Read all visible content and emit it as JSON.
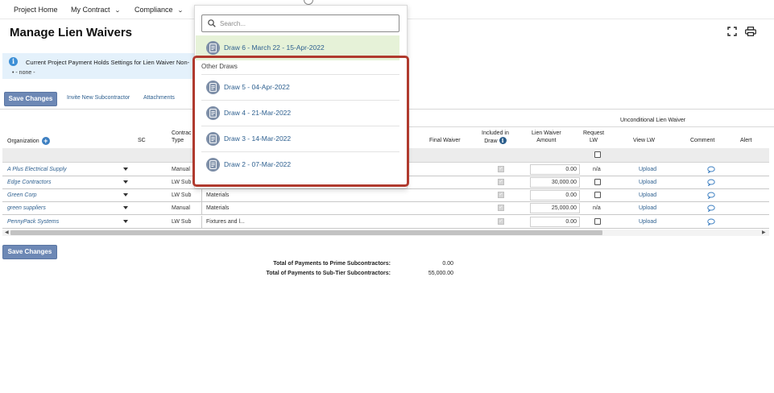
{
  "nav": {
    "project_home": "Project Home",
    "my_contract": "My Contract",
    "compliance": "Compliance"
  },
  "page_title": "Manage Lien Waivers",
  "icons": {
    "expand": "fullscreen-icon",
    "print": "print-icon",
    "search": "search-icon",
    "draw": "document-icon",
    "comment": "comment-bubble-icon",
    "add": "plus-circle-icon",
    "info": "info-icon"
  },
  "colors": {
    "primary_button": "#6d88b5",
    "link": "#2d5f8f",
    "selected_bg": "#e6f2d8",
    "highlight_border": "#b03a2e",
    "banner_bg": "#e4f1fb"
  },
  "banner": {
    "icon": "i",
    "text": "Current Project Payment Holds Settings for Lien Waiver Non-",
    "sub": "•  - none -"
  },
  "toolbar": {
    "save_label": "Save Changes",
    "invite_label": "Invite New Subcontractor",
    "attachments_label": "Attachments"
  },
  "table": {
    "group_header": "Unconditional Lien Waiver",
    "headers": {
      "organization": "Organization",
      "sc": "SC",
      "contract_type_1": "Contrac",
      "contract_type_2": "Type",
      "final_waiver": "Final Waiver",
      "included_1": "Included in",
      "included_2": "Draw",
      "lw_amount_1": "Lien Waiver",
      "lw_amount_2": "Amount",
      "request_1": "Request",
      "request_2": "LW",
      "view_lw": "View LW",
      "comment": "Comment",
      "alert": "Alert"
    },
    "rows": [
      {
        "org": "A Plus Electrical Supply",
        "type": "Manual",
        "desc": "",
        "amount": "0.00",
        "request": "n/a",
        "view": "Upload"
      },
      {
        "org": "Edge Contractors",
        "type": "LW Sub",
        "desc": "",
        "amount": "30,000.00",
        "request": "",
        "view": "Upload"
      },
      {
        "org": "Green Corp",
        "type": "LW Sub",
        "desc": "Materials",
        "amount": "0.00",
        "request": "",
        "view": "Upload"
      },
      {
        "org": "green suppliers",
        "type": "Manual",
        "desc": "Materials",
        "amount": "25,000.00",
        "request": "n/a",
        "view": "Upload"
      },
      {
        "org": "PennyPack Systems",
        "type": "LW Sub",
        "desc": "Fixtures and l...",
        "amount": "0.00",
        "request": "",
        "view": "Upload"
      }
    ]
  },
  "totals": {
    "prime_label": "Total of Payments to Prime Subcontractors:",
    "prime_value": "0.00",
    "subtier_label": "Total of Payments to Sub-Tier Subcontractors:",
    "subtier_value": "55,000.00"
  },
  "dropdown": {
    "search_placeholder": "Search...",
    "selected": "Draw 6 - March 22 - 15-Apr-2022",
    "section_label": "Other Draws",
    "other_draws": [
      "Draw 5 - 04-Apr-2022",
      "Draw 4 - 21-Mar-2022",
      "Draw 3 - 14-Mar-2022",
      "Draw 2 - 07-Mar-2022"
    ]
  }
}
